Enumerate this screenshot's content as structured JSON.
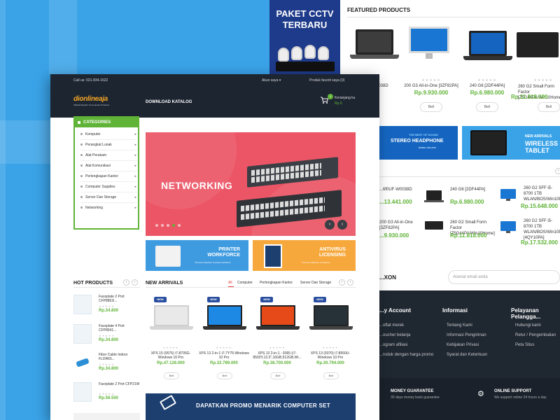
{
  "back": {
    "cctv_banner": {
      "line1": "PAKET CCTV",
      "line2": "TERBARU"
    },
    "featured": {
      "title": "FEATURED PRODUCTS",
      "items": [
        {
          "name": "...6f0UF-W0038D",
          "price": "...12.900",
          "button": "Beli"
        },
        {
          "name": "200 G3 All-in-One [3ZF82PA]",
          "price": "Rp.9.930.000",
          "button": "Beli"
        },
        {
          "name": "240 G6 [2DF44PA]",
          "price": "Rp.6.980.000",
          "button": "Beli"
        },
        {
          "name": "260 G2 Small Form Factor [Z5G44PA/Win10Home...",
          "price": "Rp.11.818.000",
          "button": "Beli"
        }
      ]
    },
    "promo_headphone": {
      "small": "THE BEST OF SOUND",
      "title": "STEREO HEADPHONE",
      "model": "MODEL H50-2015"
    },
    "promo_tablet": {
      "small": "NEW ARRIVALS",
      "title": "WIRELESS TABLET"
    },
    "list_items": [
      {
        "name": "...6f0UF-W0038D",
        "price": "...13.441.000"
      },
      {
        "name": "240 G6 [2DF44PA]",
        "price": "Rp.6.980.000"
      },
      {
        "name": "260 G2 SFF i5-8700 1TB WLAN/BOS/Win10Pro",
        "price": "Rp.15.648.000"
      },
      {
        "name": "200 G3 All-in-One [3ZF82PA]",
        "price": "...9.930.000"
      },
      {
        "name": "260 G2 Small Form Factor [Z5G44PA/Win10Home]",
        "price": "Rp.11.818.000"
      },
      {
        "name": "260 G2 SFF i5-8700 1TB WLAN/BOS/Win10Pro [4QY10PA]",
        "price": "Rp.17.532.000"
      }
    ],
    "newsletter": {
      "title": "...XON",
      "placeholder": "Alamat email anda"
    },
    "footer": {
      "col1": {
        "title": "...y Account",
        "links": [
          "...oftat merek",
          "...oucher belanja",
          "...ogram afiliasi",
          "...roduk dengan harga promo"
        ]
      },
      "col2": {
        "title": "Informasi",
        "links": [
          "Tentang Kami",
          "Informasi Pengiriman",
          "Kebijakan Privasi",
          "Syarat dan Ketentuan"
        ]
      },
      "col3": {
        "title": "Pelayanan Pelangga...",
        "links": [
          "Hubungi kami",
          "Retur / Pengembalian",
          "Peta Situs"
        ]
      },
      "money": {
        "title": "MONEY GUARANTEE",
        "sub": "30 days money back guarantee"
      },
      "support": {
        "title": "ONLINE SUPPORT",
        "sub": "We support online 24 hours a day"
      }
    }
  },
  "front": {
    "topbar": {
      "phone": "Call us: 021-834-1622",
      "account": "Akun saya ▾",
      "wishlist": "Produk favorit saya (0)"
    },
    "logo": {
      "name": "dionlineaja",
      "tagline": "Official Reseller of Computer Products"
    },
    "download": "DOWNLOAD KATALOG",
    "cart": {
      "label": "Keranjang ku",
      "total": "Rp.0",
      "count": "0"
    },
    "categories": {
      "title": "CATEGORIES",
      "items": [
        "Komputer",
        "Perangkat Lunak",
        "Alat Perakam",
        "Alat Komunikasi",
        "Perlengkapan Kantor",
        "Computer Supplies",
        "Server Dan Storage",
        "Networking"
      ]
    },
    "hero": {
      "title": "NETWORKING"
    },
    "banner_printer": {
      "title1": "PRINTER",
      "title2": "WORKFORCE",
      "sub": "The best collection of printer workforce"
    },
    "banner_av": {
      "title1": "ANTIVIRUS",
      "title2": "LICENSING",
      "sub": "The best collection of antivirus"
    },
    "hot_products": {
      "title": "HOT PRODUCTS",
      "items": [
        {
          "name": "Faceplate 2 Port CFP8852i...",
          "price": "Rp.34.800"
        },
        {
          "name": "Faceplate 4 Port CFP8541...",
          "price": "Rp.34.800"
        },
        {
          "name": "Fiber Cable Indoor FLDR60...",
          "price": "Rp.34.800"
        },
        {
          "name": "Faceplate 2 Port CFP21W",
          "price": "Rp.56.550"
        }
      ]
    },
    "new_arrivals": {
      "title": "NEW ARRIVALS",
      "tabs": [
        "All",
        "Computer",
        "Perlengkapan Kantor",
        "Server Dan Storage"
      ],
      "badge": "NEW",
      "items": [
        {
          "name": "XPS 15 (9575) i7-8705G-Windows 10 Pro",
          "price": "Rp.47.126.000",
          "button": "Beli"
        },
        {
          "name": "XPS 13 2-in-1 i7-7Y75-Windows 10 Pro",
          "price": "Rp.32.789.000",
          "button": "Beli"
        },
        {
          "name": "XPS 13 2-in-1 - 9365 (i7-8500Y,13.3\",16GB,512GB,Wi...",
          "price": "Rp.38.700.000",
          "button": "Beli"
        },
        {
          "name": "XPS 13 (9370) i7-8550U-Windows 10 Pro",
          "price": "Rp.30.794.000",
          "button": "Beli"
        }
      ]
    },
    "promo_bottom": "DAPATKAN PROMO MENARIK COMPUTER SET"
  },
  "colors": {
    "background": "#3aa3e8",
    "dark_header": "#1d2531",
    "green_accent": "#5fb336",
    "hero_red": "#ec5565",
    "printer_blue": "#3f9be0",
    "antivirus_orange": "#f6a83c",
    "promo_navy": "#1c3f70"
  },
  "icons": [
    "phone-icon",
    "user-icon",
    "heart-icon",
    "cart-icon",
    "menu-icon",
    "chevron-right-icon",
    "arrow-left-icon",
    "arrow-right-icon",
    "tag-icon",
    "gear-icon"
  ]
}
